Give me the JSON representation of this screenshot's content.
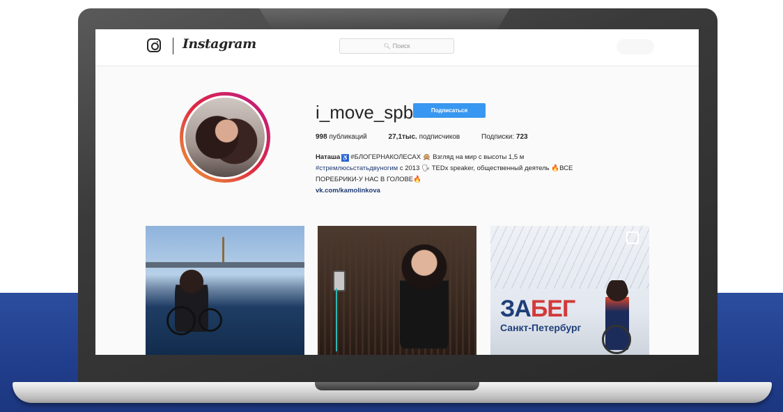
{
  "app": {
    "logo_text": "Instagram",
    "search_placeholder": "Поиск"
  },
  "profile": {
    "username": "i_move_spb",
    "follow_label": "Подписаться",
    "stats": {
      "posts_count": "998",
      "posts_label": "публикаций",
      "followers_count": "27,1тыс.",
      "followers_label": "подписчиков",
      "following_label": "Подписки:",
      "following_count": "723"
    },
    "bio": {
      "name": "Наташа",
      "line1_rest": "#БЛОГЕРНАКОЛЕСАХ 🙊 Взгляд на мир с высоты 1,5 м",
      "hashtag": "#стремлюсьстатьдвуногим",
      "line2_rest": "с 2013 🗣 TEDx speaker, общественный деятель 🔥ВСЕ",
      "line3": "ПОРЕБРИКИ-У НАС В ГОЛОВЕ🔥",
      "link": "vk.com/kamolinkova"
    }
  },
  "posts": {
    "poster_title_a": "ЗА",
    "poster_title_b": "БЕГ",
    "poster_city": "Санкт-Петербург"
  },
  "colors": {
    "follow_button": "#3897f0",
    "link": "#1e3a73",
    "background_band": "#213e8c"
  },
  "icons": [
    "instagram-camera-icon",
    "search-icon",
    "wheelchair-icon",
    "multiple-photos-icon"
  ]
}
